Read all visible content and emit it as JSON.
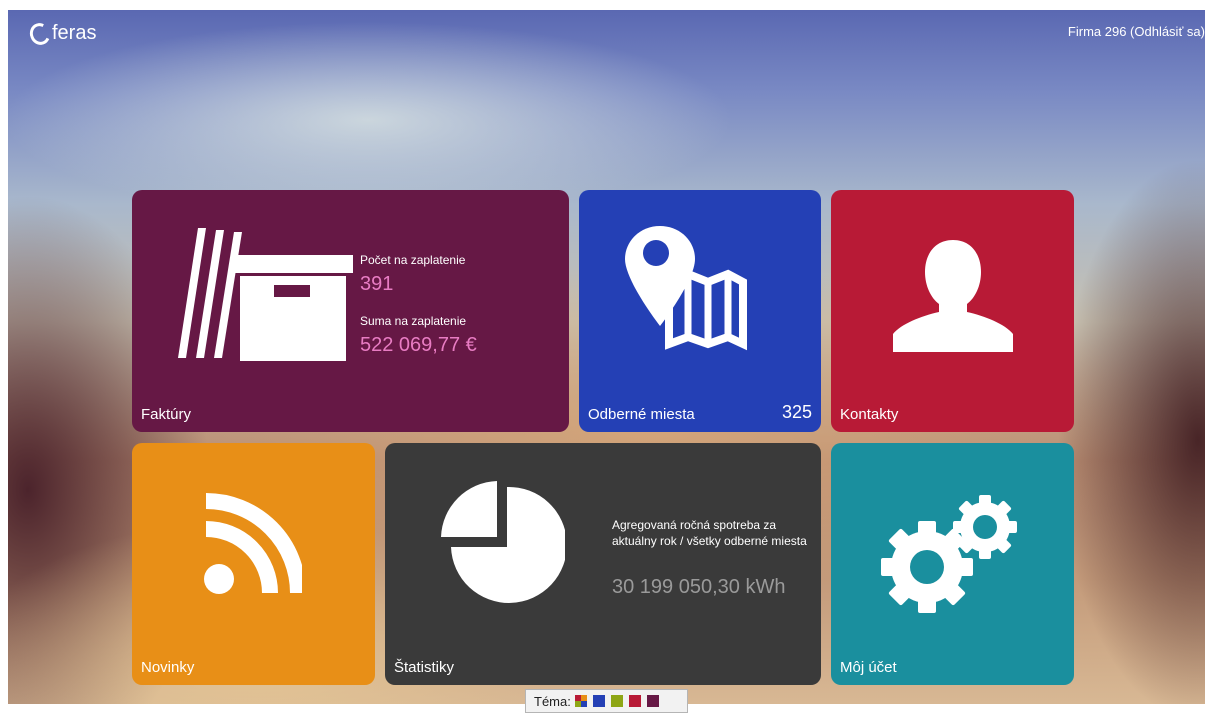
{
  "header": {
    "logo_text": "feras",
    "user_text": "Firma 296 (Odhlásiť sa)"
  },
  "tiles": {
    "faktury": {
      "title": "Faktúry",
      "count_label": "Počet na zaplatenie",
      "count_value": "391",
      "sum_label": "Suma na zaplatenie",
      "sum_value": "522 069,77 €",
      "color": "#661845",
      "icon": "archive-box-icon"
    },
    "odberne": {
      "title": "Odberné miesta",
      "count": "325",
      "color": "#2440b5",
      "icon": "map-pin-icon"
    },
    "kontakty": {
      "title": "Kontakty",
      "color": "#b81a36",
      "icon": "person-icon"
    },
    "novinky": {
      "title": "Novinky",
      "color": "#e88f17",
      "icon": "rss-icon"
    },
    "statistiky": {
      "title": "Štatistiky",
      "description": "Agregovaná ročná spotreba za aktuálny rok / všetky odberné miesta",
      "value": "30 199 050,30 kWh",
      "color": "#3a3a3a",
      "icon": "pie-chart-icon"
    },
    "ucet": {
      "title": "Môj účet",
      "color": "#1a8f9e",
      "icon": "gears-icon"
    }
  },
  "theme_picker": {
    "label": "Téma:",
    "swatches": [
      "multi",
      "#2440b5",
      "#8ea615",
      "#b81a36",
      "#661845"
    ]
  }
}
